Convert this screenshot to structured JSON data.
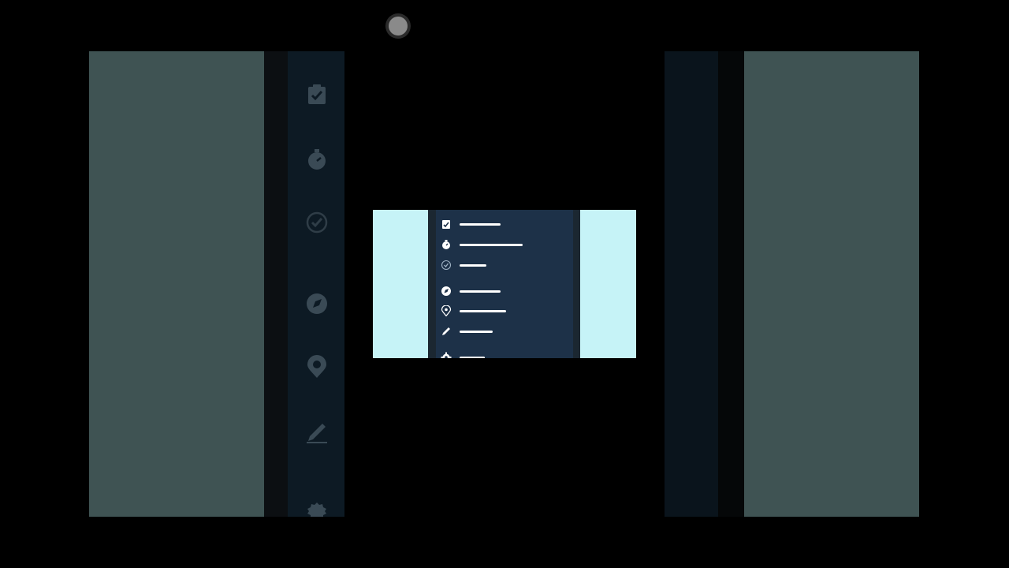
{
  "colors": {
    "backdrop": "#000000",
    "dim_panel": "#3f5353",
    "dim_nav": "#0d1a24",
    "card_bg": "#c6f3f7",
    "menu_bg": "#1d3148",
    "menu_fg": "#ffffff"
  },
  "background_nav": {
    "icons": [
      "checkbox-icon",
      "stopwatch-icon",
      "check-circle-icon",
      "compass-icon",
      "location-pin-icon",
      "pencil-icon",
      "settings-icon"
    ]
  },
  "card": {
    "menu_items": [
      {
        "icon": "checkbox-icon"
      },
      {
        "icon": "stopwatch-icon"
      },
      {
        "icon": "check-circle-icon"
      },
      {
        "icon": "compass-icon"
      },
      {
        "icon": "location-pin-icon"
      },
      {
        "icon": "pencil-icon"
      },
      {
        "icon": "settings-icon"
      }
    ]
  }
}
